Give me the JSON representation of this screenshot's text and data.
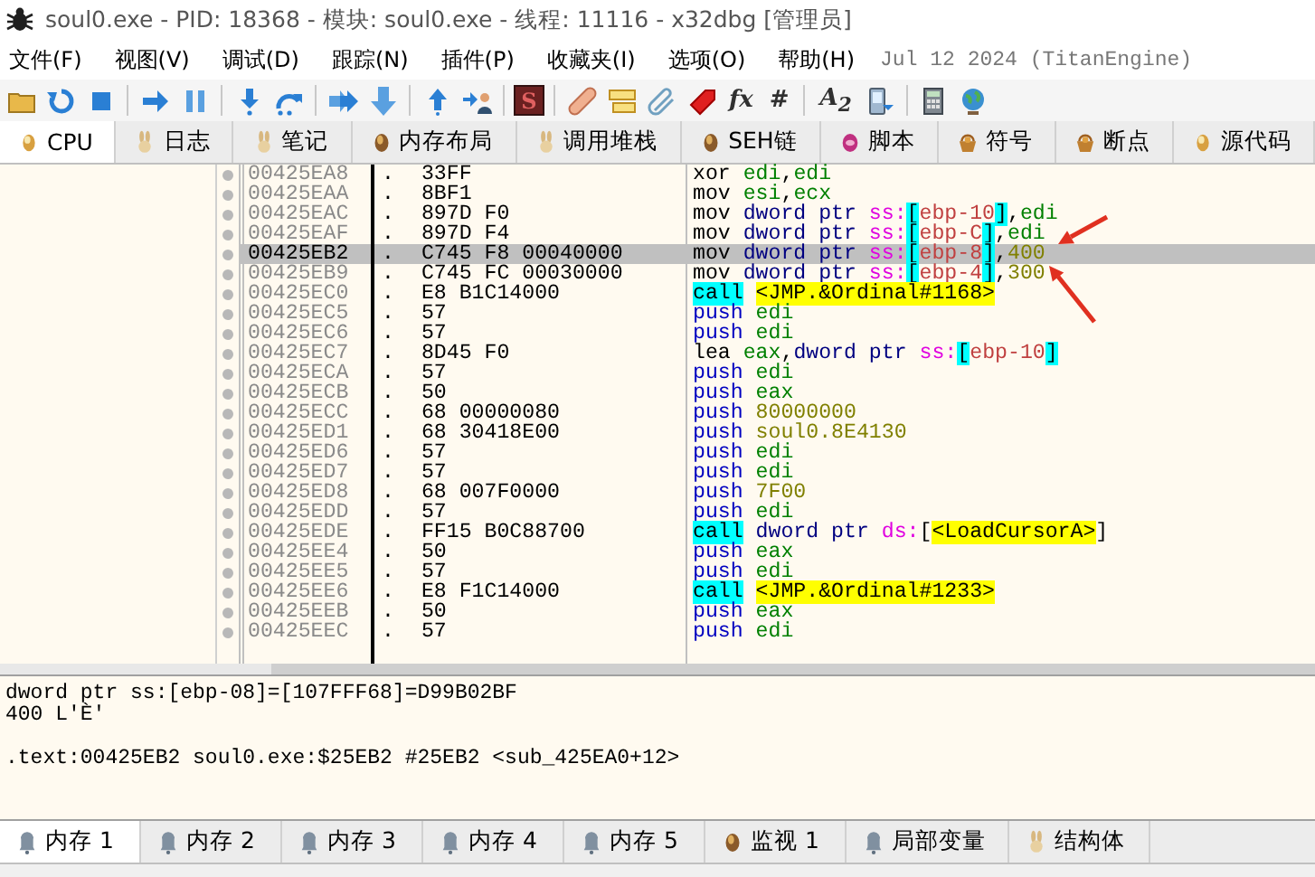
{
  "window": {
    "title": "soul0.exe - PID: 18368 - 模块: soul0.exe - 线程: 11116 - x32dbg [管理员]"
  },
  "menu": [
    "文件(F)",
    "视图(V)",
    "调试(D)",
    "跟踪(N)",
    "插件(P)",
    "收藏夹(I)",
    "选项(O)",
    "帮助(H)"
  ],
  "build_info": "Jul 12 2024 (TitanEngine)",
  "toolbar": [
    {
      "kind": "icon"
    },
    {
      "kind": "icon"
    },
    {
      "kind": "icon"
    },
    {
      "kind": "separator"
    },
    {
      "kind": "icon"
    },
    {
      "kind": "icon"
    },
    {
      "kind": "separator"
    },
    {
      "kind": "icon"
    },
    {
      "kind": "icon"
    },
    {
      "kind": "separator"
    },
    {
      "kind": "icon"
    },
    {
      "kind": "icon"
    },
    {
      "kind": "separator"
    },
    {
      "kind": "icon"
    },
    {
      "kind": "icon"
    },
    {
      "kind": "separator"
    },
    {
      "kind": "letter",
      "label": "S"
    },
    {
      "kind": "separator"
    },
    {
      "kind": "icon"
    },
    {
      "kind": "icon"
    },
    {
      "kind": "icon"
    },
    {
      "kind": "icon"
    },
    {
      "kind": "text",
      "label": "fx"
    },
    {
      "kind": "text",
      "label": "#"
    },
    {
      "kind": "separator"
    },
    {
      "kind": "text",
      "label": "A$_{2}$"
    },
    {
      "kind": "icon"
    },
    {
      "kind": "separator"
    },
    {
      "kind": "icon"
    },
    {
      "kind": "icon"
    }
  ],
  "tabs": [
    {
      "label": "CPU",
      "selected": true
    },
    {
      "label": "日志",
      "selected": false
    },
    {
      "label": "笔记",
      "selected": false
    },
    {
      "label": "内存布局",
      "selected": false
    },
    {
      "label": "调用堆栈",
      "selected": false
    },
    {
      "label": "SEH链",
      "selected": false
    },
    {
      "label": "脚本",
      "selected": false
    },
    {
      "label": "符号",
      "selected": false
    },
    {
      "label": "断点",
      "selected": false
    },
    {
      "label": "源代码",
      "selected": false
    }
  ],
  "disassembly": [
    {
      "address": "00425EA8",
      "marker": ".",
      "bytes": "33FF",
      "selected": false,
      "parts": [
        {
          "kind": "mn",
          "text": "xor "
        },
        {
          "kind": "reg",
          "text": "edi"
        },
        {
          "kind": "p",
          "text": ","
        },
        {
          "kind": "reg",
          "text": "edi"
        }
      ]
    },
    {
      "address": "00425EAA",
      "marker": ".",
      "bytes": "8BF1",
      "selected": false,
      "parts": [
        {
          "kind": "mn",
          "text": "mov "
        },
        {
          "kind": "reg",
          "text": "esi"
        },
        {
          "kind": "p",
          "text": ","
        },
        {
          "kind": "reg",
          "text": "ecx"
        }
      ]
    },
    {
      "address": "00425EAC",
      "marker": ".",
      "bytes": "897D F0",
      "selected": false,
      "parts": [
        {
          "kind": "mn",
          "text": "mov "
        },
        {
          "kind": "size",
          "text": "dword ptr "
        },
        {
          "kind": "seg",
          "text": "ss:"
        },
        {
          "kind": "br",
          "text": "["
        },
        {
          "kind": "mem",
          "text": "ebp-10"
        },
        {
          "kind": "br",
          "text": "]"
        },
        {
          "kind": "p",
          "text": ","
        },
        {
          "kind": "reg",
          "text": "edi"
        }
      ]
    },
    {
      "address": "00425EAF",
      "marker": ".",
      "bytes": "897D F4",
      "selected": false,
      "parts": [
        {
          "kind": "mn",
          "text": "mov "
        },
        {
          "kind": "size",
          "text": "dword ptr "
        },
        {
          "kind": "seg",
          "text": "ss:"
        },
        {
          "kind": "br",
          "text": "["
        },
        {
          "kind": "mem",
          "text": "ebp-C"
        },
        {
          "kind": "br",
          "text": "]"
        },
        {
          "kind": "p",
          "text": ","
        },
        {
          "kind": "reg",
          "text": "edi"
        }
      ]
    },
    {
      "address": "00425EB2",
      "marker": ".",
      "bytes": "C745 F8 00040000",
      "selected": true,
      "parts": [
        {
          "kind": "mn",
          "text": "mov "
        },
        {
          "kind": "size",
          "text": "dword ptr "
        },
        {
          "kind": "seg",
          "text": "ss:"
        },
        {
          "kind": "br",
          "text": "["
        },
        {
          "kind": "mem",
          "text": "ebp-8"
        },
        {
          "kind": "br",
          "text": "]"
        },
        {
          "kind": "p",
          "text": ","
        },
        {
          "kind": "num",
          "text": "400"
        }
      ]
    },
    {
      "address": "00425EB9",
      "marker": ".",
      "bytes": "C745 FC 00030000",
      "selected": false,
      "parts": [
        {
          "kind": "mn",
          "text": "mov "
        },
        {
          "kind": "size",
          "text": "dword ptr "
        },
        {
          "kind": "seg",
          "text": "ss:"
        },
        {
          "kind": "br",
          "text": "["
        },
        {
          "kind": "mem",
          "text": "ebp-4"
        },
        {
          "kind": "br",
          "text": "]"
        },
        {
          "kind": "p",
          "text": ","
        },
        {
          "kind": "num",
          "text": "300"
        }
      ]
    },
    {
      "address": "00425EC0",
      "marker": ".",
      "bytes": "E8 B1C14000",
      "selected": false,
      "parts": [
        {
          "kind": "call",
          "text": "call"
        },
        {
          "kind": "label",
          "text": "<JMP.&Ordinal#1168>"
        }
      ]
    },
    {
      "address": "00425EC5",
      "marker": ".",
      "bytes": "57",
      "selected": false,
      "parts": [
        {
          "kind": "push",
          "text": "push "
        },
        {
          "kind": "reg",
          "text": "edi"
        }
      ]
    },
    {
      "address": "00425EC6",
      "marker": ".",
      "bytes": "57",
      "selected": false,
      "parts": [
        {
          "kind": "push",
          "text": "push "
        },
        {
          "kind": "reg",
          "text": "edi"
        }
      ]
    },
    {
      "address": "00425EC7",
      "marker": ".",
      "bytes": "8D45 F0",
      "selected": false,
      "parts": [
        {
          "kind": "mn",
          "text": "lea "
        },
        {
          "kind": "reg",
          "text": "eax"
        },
        {
          "kind": "p",
          "text": ","
        },
        {
          "kind": "size",
          "text": "dword ptr "
        },
        {
          "kind": "seg",
          "text": "ss:"
        },
        {
          "kind": "br",
          "text": "["
        },
        {
          "kind": "mem",
          "text": "ebp-10"
        },
        {
          "kind": "br",
          "text": "]"
        }
      ]
    },
    {
      "address": "00425ECA",
      "marker": ".",
      "bytes": "57",
      "selected": false,
      "parts": [
        {
          "kind": "push",
          "text": "push "
        },
        {
          "kind": "reg",
          "text": "edi"
        }
      ]
    },
    {
      "address": "00425ECB",
      "marker": ".",
      "bytes": "50",
      "selected": false,
      "parts": [
        {
          "kind": "push",
          "text": "push "
        },
        {
          "kind": "reg",
          "text": "eax"
        }
      ]
    },
    {
      "address": "00425ECC",
      "marker": ".",
      "bytes": "68 00000080",
      "selected": false,
      "parts": [
        {
          "kind": "push",
          "text": "push "
        },
        {
          "kind": "num",
          "text": "80000000"
        }
      ]
    },
    {
      "address": "00425ED1",
      "marker": ".",
      "bytes": "68 30418E00",
      "selected": false,
      "parts": [
        {
          "kind": "push",
          "text": "push "
        },
        {
          "kind": "num",
          "text": "soul0.8E4130"
        }
      ]
    },
    {
      "address": "00425ED6",
      "marker": ".",
      "bytes": "57",
      "selected": false,
      "parts": [
        {
          "kind": "push",
          "text": "push "
        },
        {
          "kind": "reg",
          "text": "edi"
        }
      ]
    },
    {
      "address": "00425ED7",
      "marker": ".",
      "bytes": "57",
      "selected": false,
      "parts": [
        {
          "kind": "push",
          "text": "push "
        },
        {
          "kind": "reg",
          "text": "edi"
        }
      ]
    },
    {
      "address": "00425ED8",
      "marker": ".",
      "bytes": "68 007F0000",
      "selected": false,
      "parts": [
        {
          "kind": "push",
          "text": "push "
        },
        {
          "kind": "num",
          "text": "7F00"
        }
      ]
    },
    {
      "address": "00425EDD",
      "marker": ".",
      "bytes": "57",
      "selected": false,
      "parts": [
        {
          "kind": "push",
          "text": "push "
        },
        {
          "kind": "reg",
          "text": "edi"
        }
      ]
    },
    {
      "address": "00425EDE",
      "marker": ".",
      "bytes": "FF15 B0C88700",
      "selected": false,
      "parts": [
        {
          "kind": "call",
          "text": "call"
        },
        {
          "kind": "size",
          "text": "dword ptr "
        },
        {
          "kind": "seg",
          "text": "ds:"
        },
        {
          "kind": "p",
          "text": "["
        },
        {
          "kind": "label",
          "text": "<LoadCursorA>"
        },
        {
          "kind": "p",
          "text": "]"
        }
      ]
    },
    {
      "address": "00425EE4",
      "marker": ".",
      "bytes": "50",
      "selected": false,
      "parts": [
        {
          "kind": "push",
          "text": "push "
        },
        {
          "kind": "reg",
          "text": "eax"
        }
      ]
    },
    {
      "address": "00425EE5",
      "marker": ".",
      "bytes": "57",
      "selected": false,
      "parts": [
        {
          "kind": "push",
          "text": "push "
        },
        {
          "kind": "reg",
          "text": "edi"
        }
      ]
    },
    {
      "address": "00425EE6",
      "marker": ".",
      "bytes": "E8 F1C14000",
      "selected": false,
      "parts": [
        {
          "kind": "call",
          "text": "call"
        },
        {
          "kind": "label",
          "text": "<JMP.&Ordinal#1233>"
        }
      ]
    },
    {
      "address": "00425EEB",
      "marker": ".",
      "bytes": "50",
      "selected": false,
      "parts": [
        {
          "kind": "push",
          "text": "push "
        },
        {
          "kind": "reg",
          "text": "eax"
        }
      ]
    },
    {
      "address": "00425EEC",
      "marker": ".",
      "bytes": "57",
      "selected": false,
      "parts": [
        {
          "kind": "push",
          "text": "push "
        },
        {
          "kind": "reg",
          "text": "edi"
        }
      ]
    }
  ],
  "info": {
    "value_lines": [
      "dword ptr ss:[ebp-08]=[107FFF68]=D99B02BF",
      "400 L'Ѐ'"
    ],
    "location": ".text:00425EB2 soul0.exe:$25EB2 #25EB2 <sub_425EA0+12>"
  },
  "bottom_tabs": [
    {
      "label": "内存 1",
      "selected": true
    },
    {
      "label": "内存 2",
      "selected": false
    },
    {
      "label": "内存 3",
      "selected": false
    },
    {
      "label": "内存 4",
      "selected": false
    },
    {
      "label": "内存 5",
      "selected": false
    },
    {
      "label": "监视 1",
      "selected": false
    },
    {
      "label": "局部变量",
      "selected": false
    },
    {
      "label": "结构体",
      "selected": false
    }
  ]
}
